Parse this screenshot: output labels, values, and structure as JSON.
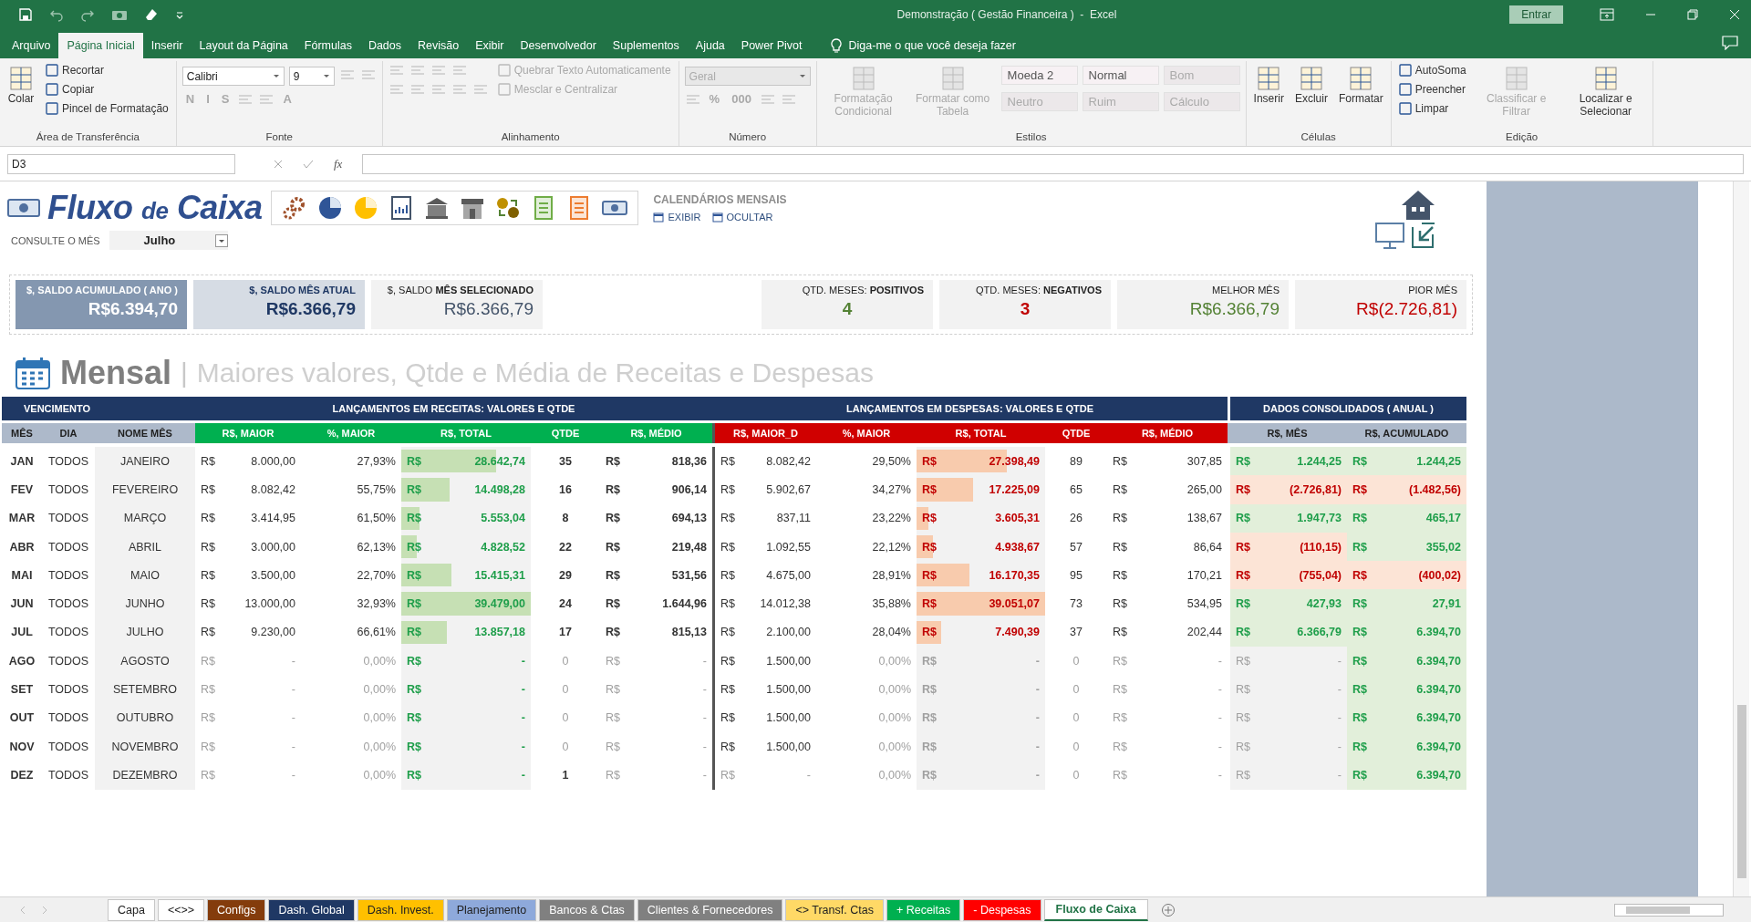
{
  "title_bar": {
    "title": "Demonstração ( Gestão Financeira )  -  Excel",
    "sign_in": "Entrar"
  },
  "ribbon": {
    "tabs": [
      {
        "label": "Arquivo",
        "selected": false
      },
      {
        "label": "Página Inicial",
        "selected": true
      },
      {
        "label": "Inserir",
        "selected": false
      },
      {
        "label": "Layout da Página",
        "selected": false
      },
      {
        "label": "Fórmulas",
        "selected": false
      },
      {
        "label": "Dados",
        "selected": false
      },
      {
        "label": "Revisão",
        "selected": false
      },
      {
        "label": "Exibir",
        "selected": false
      },
      {
        "label": "Desenvolvedor",
        "selected": false
      },
      {
        "label": "Suplementos",
        "selected": false
      },
      {
        "label": "Ajuda",
        "selected": false
      },
      {
        "label": "Power Pivot",
        "selected": false
      }
    ],
    "tell_me": "Diga-me o que você deseja fazer",
    "groups": [
      {
        "label": "Área de Transferência",
        "columns": [
          [
            [
              {
                "kind": "large",
                "label": "Colar",
                "disabled": false
              }
            ]
          ],
          [
            [
              {
                "kind": "small",
                "label": "Recortar",
                "disabled": false
              }
            ],
            [
              {
                "kind": "small",
                "label": "Copiar",
                "disabled": false
              }
            ],
            [
              {
                "kind": "small",
                "label": "Pincel de Formatação",
                "disabled": false
              }
            ]
          ]
        ]
      },
      {
        "label": "Fonte",
        "columns": [
          [
            [
              {
                "kind": "combo",
                "label": "Calibri",
                "disabled": false
              },
              {
                "kind": "combo",
                "label": "9",
                "disabled": false
              },
              {
                "kind": "icon",
                "disabled": true
              },
              {
                "kind": "icon",
                "disabled": true
              }
            ],
            [
              {
                "kind": "glyph",
                "label": "N",
                "disabled": true
              },
              {
                "kind": "glyph",
                "label": "I",
                "disabled": true
              },
              {
                "kind": "glyph",
                "label": "S",
                "disabled": true
              },
              {
                "kind": "icon",
                "disabled": true
              },
              {
                "kind": "icon",
                "disabled": true
              },
              {
                "kind": "glyph",
                "label": "A",
                "disabled": true
              }
            ]
          ]
        ]
      },
      {
        "label": "Alinhamento",
        "columns": [
          [
            [
              {
                "kind": "icon",
                "disabled": true
              },
              {
                "kind": "icon",
                "disabled": true
              },
              {
                "kind": "icon",
                "disabled": true
              },
              {
                "kind": "icon",
                "disabled": true
              }
            ],
            [
              {
                "kind": "icon",
                "disabled": true
              },
              {
                "kind": "icon",
                "disabled": true
              },
              {
                "kind": "icon",
                "disabled": true
              },
              {
                "kind": "icon",
                "disabled": true
              },
              {
                "kind": "icon",
                "disabled": true
              }
            ]
          ],
          [
            [
              {
                "kind": "small",
                "label": "Quebrar Texto Automaticamente",
                "disabled": true
              }
            ],
            [
              {
                "kind": "small",
                "label": "Mesclar e Centralizar",
                "disabled": true
              }
            ]
          ]
        ]
      },
      {
        "label": "Número",
        "columns": [
          [
            [
              {
                "kind": "combo",
                "label": "Geral",
                "disabled": true
              }
            ],
            [
              {
                "kind": "icon",
                "disabled": true
              },
              {
                "kind": "glyph",
                "label": "%",
                "disabled": true
              },
              {
                "kind": "glyph",
                "label": "000",
                "disabled": true
              },
              {
                "kind": "icon",
                "disabled": true
              },
              {
                "kind": "icon",
                "disabled": true
              }
            ]
          ]
        ]
      },
      {
        "label": "Estilos",
        "columns": [
          [
            [
              {
                "kind": "large",
                "label": "Formatação Condicional",
                "disabled": true
              }
            ]
          ],
          [
            [
              {
                "kind": "large",
                "label": "Formatar como Tabela",
                "disabled": true
              }
            ]
          ],
          [
            [
              {
                "kind": "style",
                "label": "Moeda 2",
                "disabled": false
              },
              {
                "kind": "style",
                "label": "Normal",
                "disabled": false
              },
              {
                "kind": "style",
                "label": "Bom",
                "disabled": true
              }
            ],
            [
              {
                "kind": "style",
                "label": "Neutro",
                "disabled": true
              },
              {
                "kind": "style",
                "label": "Ruim",
                "disabled": true
              },
              {
                "kind": "style",
                "label": "Cálculo",
                "disabled": true
              }
            ]
          ]
        ]
      },
      {
        "label": "Células",
        "columns": [
          [
            [
              {
                "kind": "large",
                "label": "Inserir",
                "disabled": false
              }
            ]
          ],
          [
            [
              {
                "kind": "large",
                "label": "Excluir",
                "disabled": false
              }
            ]
          ],
          [
            [
              {
                "kind": "large",
                "label": "Formatar",
                "disabled": false
              }
            ]
          ]
        ]
      },
      {
        "label": "Edição",
        "columns": [
          [
            [
              {
                "kind": "small",
                "label": "AutoSoma",
                "disabled": false
              }
            ],
            [
              {
                "kind": "small",
                "label": "Preencher",
                "disabled": false
              }
            ],
            [
              {
                "kind": "small",
                "label": "Limpar",
                "disabled": false
              }
            ]
          ],
          [
            [
              {
                "kind": "large",
                "label": "Classificar e Filtrar",
                "disabled": true
              }
            ]
          ],
          [
            [
              {
                "kind": "large",
                "label": "Localizar e Selecionar",
                "disabled": false
              }
            ]
          ]
        ]
      }
    ]
  },
  "formula_bar": {
    "name_box": "D3",
    "fx": "fx"
  },
  "dashboard": {
    "logo": {
      "first": "Fluxo",
      "joiner": "de",
      "last": "Caixa"
    },
    "calendars": {
      "title": "CALENDÁRIOS MENSAIS",
      "show": "EXIBIR",
      "hide": "OCULTAR"
    },
    "month_picker": {
      "label": "CONSULTE O MÊS",
      "value": "Julho"
    },
    "kpis": [
      {
        "kind": "dark",
        "label": "$, SALDO ACUMULADO ( ANO )",
        "value": "R$6.394,70",
        "positive": false,
        "negative": false
      },
      {
        "kind": "light",
        "label": "$, SALDO MÊS ATUAL",
        "value": "R$6.366,79",
        "positive": false,
        "negative": false
      },
      {
        "kind": "plain",
        "label": "$, SALDO **MÊS SELECIONADO**",
        "value": "R$6.366,79",
        "positive": false,
        "negative": false
      },
      {
        "kind": "count",
        "label": "QTD. MESES: **POSITIVOS**",
        "value": "4",
        "positive": true,
        "negative": false
      },
      {
        "kind": "count",
        "label": "QTD. MESES: **NEGATIVOS**",
        "value": "3",
        "positive": false,
        "negative": true
      },
      {
        "kind": "plain",
        "label": "MELHOR MÊS",
        "value": "R$6.366,79",
        "positive": true,
        "negative": false
      },
      {
        "kind": "plain",
        "label": "PIOR MÊS",
        "value": "R$(2.726,81)",
        "positive": false,
        "negative": true
      }
    ]
  },
  "section": {
    "title": "Mensal",
    "separator": "|",
    "subtitle": "Maiores valores, Qtde e Média de Receitas e Despesas"
  },
  "table": {
    "group_headers": [
      {
        "label": "VENCIMENTO"
      },
      {
        "label": "LANÇAMENTOS EM RECEITAS: VALORES E QTDE"
      },
      {
        "label": "LANÇAMENTOS EM DESPESAS: VALORES E QTDE"
      },
      {
        "label": "DADOS CONSOLIDADOS ( ANUAL )"
      }
    ],
    "columns": [
      {
        "label": "MÊS",
        "kind": "venc"
      },
      {
        "label": "DIA",
        "kind": "venc"
      },
      {
        "label": "NOME MÊS",
        "kind": "venc"
      },
      {
        "label": "R$, MAIOR",
        "kind": "rec"
      },
      {
        "label": "%, MAIOR",
        "kind": "rec"
      },
      {
        "label": "R$, TOTAL",
        "kind": "rec"
      },
      {
        "label": "QTDE",
        "kind": "rec"
      },
      {
        "label": "R$, MÉDIO",
        "kind": "rec"
      },
      {
        "label": "R$, MAIOR_D",
        "kind": "desp"
      },
      {
        "label": "%, MAIOR",
        "kind": "desp"
      },
      {
        "label": "R$, TOTAL",
        "kind": "desp"
      },
      {
        "label": "QTDE",
        "kind": "desp"
      },
      {
        "label": "R$, MÉDIO",
        "kind": "desp"
      },
      {
        "label": "R$, MÊS",
        "kind": "cons"
      },
      {
        "label": "R$, ACUMULADO",
        "kind": "cons"
      }
    ],
    "rows": [
      {
        "month": "JAN",
        "day": "TODOS",
        "name": "JANEIRO",
        "rec": {
          "active": true,
          "qtde_active": true,
          "maior": [
            "R$",
            "8.000,00"
          ],
          "pct": "27,93%",
          "total": [
            "R$",
            "28.642,74"
          ],
          "level": 0.73,
          "qtde": "35",
          "medio": [
            "R$",
            "818,36"
          ]
        },
        "desp": {
          "active": true,
          "maior_active": true,
          "maior": [
            "R$",
            "8.082,42"
          ],
          "pct": "29,50%",
          "total": [
            "R$",
            "27.398,49"
          ],
          "level": 0.7,
          "qtde": "89",
          "medio": [
            "R$",
            "307,85"
          ]
        },
        "mes": {
          "active": true,
          "negative": false,
          "value": [
            "R$",
            "1.244,25"
          ]
        },
        "acum": {
          "negative": false,
          "value": [
            "R$",
            "1.244,25"
          ]
        }
      },
      {
        "month": "FEV",
        "day": "TODOS",
        "name": "FEVEREIRO",
        "rec": {
          "active": true,
          "qtde_active": true,
          "maior": [
            "R$",
            "8.082,42"
          ],
          "pct": "55,75%",
          "total": [
            "R$",
            "14.498,28"
          ],
          "level": 0.37,
          "qtde": "16",
          "medio": [
            "R$",
            "906,14"
          ]
        },
        "desp": {
          "active": true,
          "maior_active": true,
          "maior": [
            "R$",
            "5.902,67"
          ],
          "pct": "34,27%",
          "total": [
            "R$",
            "17.225,09"
          ],
          "level": 0.44,
          "qtde": "65",
          "medio": [
            "R$",
            "265,00"
          ]
        },
        "mes": {
          "active": true,
          "negative": true,
          "value": [
            "R$",
            "(2.726,81)"
          ]
        },
        "acum": {
          "negative": true,
          "value": [
            "R$",
            "(1.482,56)"
          ]
        }
      },
      {
        "month": "MAR",
        "day": "TODOS",
        "name": "MARÇO",
        "rec": {
          "active": true,
          "qtde_active": true,
          "maior": [
            "R$",
            "3.414,95"
          ],
          "pct": "61,50%",
          "total": [
            "R$",
            "5.553,04"
          ],
          "level": 0.14,
          "qtde": "8",
          "medio": [
            "R$",
            "694,13"
          ]
        },
        "desp": {
          "active": true,
          "maior_active": true,
          "maior": [
            "R$",
            "837,11"
          ],
          "pct": "23,22%",
          "total": [
            "R$",
            "3.605,31"
          ],
          "level": 0.09,
          "qtde": "26",
          "medio": [
            "R$",
            "138,67"
          ]
        },
        "mes": {
          "active": true,
          "negative": false,
          "value": [
            "R$",
            "1.947,73"
          ]
        },
        "acum": {
          "negative": false,
          "value": [
            "R$",
            "465,17"
          ]
        }
      },
      {
        "month": "ABR",
        "day": "TODOS",
        "name": "ABRIL",
        "rec": {
          "active": true,
          "qtde_active": true,
          "maior": [
            "R$",
            "3.000,00"
          ],
          "pct": "62,13%",
          "total": [
            "R$",
            "4.828,52"
          ],
          "level": 0.12,
          "qtde": "22",
          "medio": [
            "R$",
            "219,48"
          ]
        },
        "desp": {
          "active": true,
          "maior_active": true,
          "maior": [
            "R$",
            "1.092,55"
          ],
          "pct": "22,12%",
          "total": [
            "R$",
            "4.938,67"
          ],
          "level": 0.13,
          "qtde": "57",
          "medio": [
            "R$",
            "86,64"
          ]
        },
        "mes": {
          "active": true,
          "negative": true,
          "value": [
            "R$",
            "(110,15)"
          ]
        },
        "acum": {
          "negative": false,
          "value": [
            "R$",
            "355,02"
          ]
        }
      },
      {
        "month": "MAI",
        "day": "TODOS",
        "name": "MAIO",
        "rec": {
          "active": true,
          "qtde_active": true,
          "maior": [
            "R$",
            "3.500,00"
          ],
          "pct": "22,70%",
          "total": [
            "R$",
            "15.415,31"
          ],
          "level": 0.39,
          "qtde": "29",
          "medio": [
            "R$",
            "531,56"
          ]
        },
        "desp": {
          "active": true,
          "maior_active": true,
          "maior": [
            "R$",
            "4.675,00"
          ],
          "pct": "28,91%",
          "total": [
            "R$",
            "16.170,35"
          ],
          "level": 0.41,
          "qtde": "95",
          "medio": [
            "R$",
            "170,21"
          ]
        },
        "mes": {
          "active": true,
          "negative": true,
          "value": [
            "R$",
            "(755,04)"
          ]
        },
        "acum": {
          "negative": true,
          "value": [
            "R$",
            "(400,02)"
          ]
        }
      },
      {
        "month": "JUN",
        "day": "TODOS",
        "name": "JUNHO",
        "rec": {
          "active": true,
          "qtde_active": true,
          "maior": [
            "R$",
            "13.000,00"
          ],
          "pct": "32,93%",
          "total": [
            "R$",
            "39.479,00"
          ],
          "level": 1,
          "qtde": "24",
          "medio": [
            "R$",
            "1.644,96"
          ]
        },
        "desp": {
          "active": true,
          "maior_active": true,
          "maior": [
            "R$",
            "14.012,38"
          ],
          "pct": "35,88%",
          "total": [
            "R$",
            "39.051,07"
          ],
          "level": 1,
          "qtde": "73",
          "medio": [
            "R$",
            "534,95"
          ]
        },
        "mes": {
          "active": true,
          "negative": false,
          "value": [
            "R$",
            "427,93"
          ]
        },
        "acum": {
          "negative": false,
          "value": [
            "R$",
            "27,91"
          ]
        }
      },
      {
        "month": "JUL",
        "day": "TODOS",
        "name": "JULHO",
        "rec": {
          "active": true,
          "qtde_active": true,
          "maior": [
            "R$",
            "9.230,00"
          ],
          "pct": "66,61%",
          "total": [
            "R$",
            "13.857,18"
          ],
          "level": 0.35,
          "qtde": "17",
          "medio": [
            "R$",
            "815,13"
          ]
        },
        "desp": {
          "active": true,
          "maior_active": true,
          "maior": [
            "R$",
            "2.100,00"
          ],
          "pct": "28,04%",
          "total": [
            "R$",
            "7.490,39"
          ],
          "level": 0.19,
          "qtde": "37",
          "medio": [
            "R$",
            "202,44"
          ]
        },
        "mes": {
          "active": true,
          "negative": false,
          "value": [
            "R$",
            "6.366,79"
          ]
        },
        "acum": {
          "negative": false,
          "value": [
            "R$",
            "6.394,70"
          ]
        }
      },
      {
        "month": "AGO",
        "day": "TODOS",
        "name": "AGOSTO",
        "rec": {
          "active": false,
          "qtde_active": false,
          "maior": [
            "R$",
            "-"
          ],
          "pct": "0,00%",
          "total": [
            "R$",
            "-"
          ],
          "qtde": "0",
          "medio": [
            "R$",
            "-"
          ]
        },
        "desp": {
          "active": false,
          "maior_active": true,
          "maior": [
            "R$",
            "1.500,00"
          ],
          "pct": "0,00%",
          "total": [
            "R$",
            "-"
          ],
          "qtde": "0",
          "medio": [
            "R$",
            "-"
          ]
        },
        "mes": {
          "active": false,
          "value": [
            "R$",
            "-"
          ]
        },
        "acum": {
          "negative": false,
          "value": [
            "R$",
            "6.394,70"
          ]
        }
      },
      {
        "month": "SET",
        "day": "TODOS",
        "name": "SETEMBRO",
        "rec": {
          "active": false,
          "qtde_active": false,
          "maior": [
            "R$",
            "-"
          ],
          "pct": "0,00%",
          "total": [
            "R$",
            "-"
          ],
          "qtde": "0",
          "medio": [
            "R$",
            "-"
          ]
        },
        "desp": {
          "active": false,
          "maior_active": true,
          "maior": [
            "R$",
            "1.500,00"
          ],
          "pct": "0,00%",
          "total": [
            "R$",
            "-"
          ],
          "qtde": "0",
          "medio": [
            "R$",
            "-"
          ]
        },
        "mes": {
          "active": false,
          "value": [
            "R$",
            "-"
          ]
        },
        "acum": {
          "negative": false,
          "value": [
            "R$",
            "6.394,70"
          ]
        }
      },
      {
        "month": "OUT",
        "day": "TODOS",
        "name": "OUTUBRO",
        "rec": {
          "active": false,
          "qtde_active": false,
          "maior": [
            "R$",
            "-"
          ],
          "pct": "0,00%",
          "total": [
            "R$",
            "-"
          ],
          "qtde": "0",
          "medio": [
            "R$",
            "-"
          ]
        },
        "desp": {
          "active": false,
          "maior_active": true,
          "maior": [
            "R$",
            "1.500,00"
          ],
          "pct": "0,00%",
          "total": [
            "R$",
            "-"
          ],
          "qtde": "0",
          "medio": [
            "R$",
            "-"
          ]
        },
        "mes": {
          "active": false,
          "value": [
            "R$",
            "-"
          ]
        },
        "acum": {
          "negative": false,
          "value": [
            "R$",
            "6.394,70"
          ]
        }
      },
      {
        "month": "NOV",
        "day": "TODOS",
        "name": "NOVEMBRO",
        "rec": {
          "active": false,
          "qtde_active": false,
          "maior": [
            "R$",
            "-"
          ],
          "pct": "0,00%",
          "total": [
            "R$",
            "-"
          ],
          "qtde": "0",
          "medio": [
            "R$",
            "-"
          ]
        },
        "desp": {
          "active": false,
          "maior_active": true,
          "maior": [
            "R$",
            "1.500,00"
          ],
          "pct": "0,00%",
          "total": [
            "R$",
            "-"
          ],
          "qtde": "0",
          "medio": [
            "R$",
            "-"
          ]
        },
        "mes": {
          "active": false,
          "value": [
            "R$",
            "-"
          ]
        },
        "acum": {
          "negative": false,
          "value": [
            "R$",
            "6.394,70"
          ]
        }
      },
      {
        "month": "DEZ",
        "day": "TODOS",
        "name": "DEZEMBRO",
        "rec": {
          "active": false,
          "qtde_active": true,
          "maior": [
            "R$",
            "-"
          ],
          "pct": "0,00%",
          "total": [
            "R$",
            "-"
          ],
          "qtde": "1",
          "medio": [
            "R$",
            "-"
          ]
        },
        "desp": {
          "active": false,
          "maior_active": false,
          "maior": [
            "R$",
            "-"
          ],
          "pct": "0,00%",
          "total": [
            "R$",
            "-"
          ],
          "qtde": "0",
          "medio": [
            "R$",
            "-"
          ]
        },
        "mes": {
          "active": false,
          "value": [
            "R$",
            "-"
          ]
        },
        "acum": {
          "negative": false,
          "value": [
            "R$",
            "6.394,70"
          ]
        }
      }
    ]
  },
  "sheet_tabs": [
    {
      "label": "Capa",
      "color": "#ffffff",
      "selected": false
    },
    {
      "label": "<<>>",
      "color": "#ffffff",
      "selected": false
    },
    {
      "label": "Configs",
      "color": "#843c0c",
      "selected": false
    },
    {
      "label": "Dash. Global",
      "color": "#1f3864",
      "selected": false
    },
    {
      "label": "Dash. Invest.",
      "color": "#ffc000",
      "selected": false
    },
    {
      "label": "Planejamento",
      "color": "#8ea9db",
      "selected": false
    },
    {
      "label": "Bancos & Ctas",
      "color": "#808080",
      "selected": false
    },
    {
      "label": "Clientes & Fornecedores",
      "color": "#808080",
      "selected": false
    },
    {
      "label": "<> Transf. Ctas",
      "color": "#ffd966",
      "selected": false
    },
    {
      "label": "+ Receitas",
      "color": "#00b050",
      "selected": false
    },
    {
      "label": "- Despesas",
      "color": "#ff0000",
      "selected": false
    },
    {
      "label": "Fluxo de Caixa",
      "selected": true
    }
  ]
}
